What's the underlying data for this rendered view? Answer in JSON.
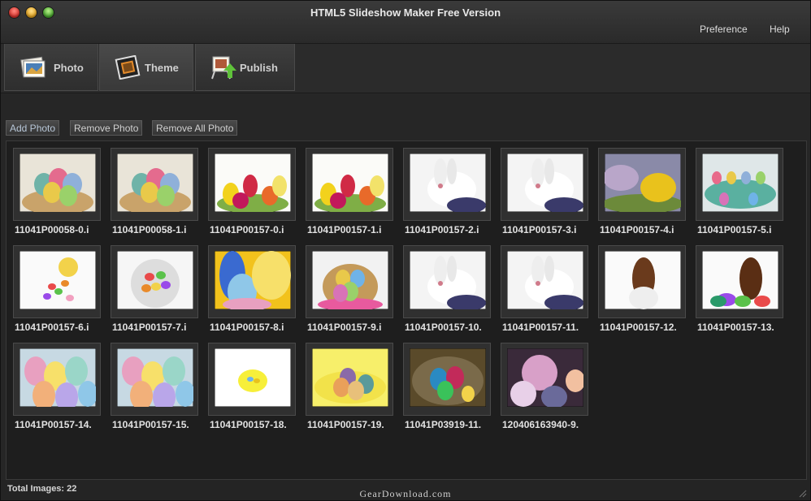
{
  "window": {
    "title": "HTML5 Slideshow Maker Free Version",
    "menu": {
      "preference": "Preference",
      "help": "Help"
    }
  },
  "tabs": [
    {
      "label": "Photo",
      "icon": "photo-stack-icon"
    },
    {
      "label": "Theme",
      "icon": "theme-frame-icon"
    },
    {
      "label": "Publish",
      "icon": "publish-upload-icon"
    }
  ],
  "toolbar": {
    "add": "Add Photo",
    "remove": "Remove Photo",
    "remove_all": "Remove All Photo"
  },
  "photos": [
    {
      "name": "11041P00058-0.i",
      "theme": "eggs-basket"
    },
    {
      "name": "11041P00058-1.i",
      "theme": "eggs-basket"
    },
    {
      "name": "11041P00157-0.i",
      "theme": "tulips"
    },
    {
      "name": "11041P00157-1.i",
      "theme": "tulips"
    },
    {
      "name": "11041P00157-2.i",
      "theme": "bunny"
    },
    {
      "name": "11041P00157-3.i",
      "theme": "bunny"
    },
    {
      "name": "11041P00157-4.i",
      "theme": "eggs-grass"
    },
    {
      "name": "11041P00157-5.i",
      "theme": "eggs-carton"
    },
    {
      "name": "11041P00157-6.i",
      "theme": "jellybeans"
    },
    {
      "name": "11041P00157-7.i",
      "theme": "jellybean-bowl"
    },
    {
      "name": "11041P00157-8.i",
      "theme": "egg-cup"
    },
    {
      "name": "11041P00157-9.i",
      "theme": "eggs-basket-pink"
    },
    {
      "name": "11041P00157-10.",
      "theme": "bunny"
    },
    {
      "name": "11041P00157-11.",
      "theme": "bunny"
    },
    {
      "name": "11041P00157-12.",
      "theme": "chocolate-bunny"
    },
    {
      "name": "11041P00157-13.",
      "theme": "chocolate-bunny-eggs"
    },
    {
      "name": "11041P00157-14.",
      "theme": "pastel-eggs"
    },
    {
      "name": "11041P00157-15.",
      "theme": "pastel-eggs"
    },
    {
      "name": "11041P00157-18.",
      "theme": "nest-small"
    },
    {
      "name": "11041P00157-19.",
      "theme": "nest-eggs"
    },
    {
      "name": "11041P03919-11.",
      "theme": "dark-eggs"
    },
    {
      "name": "120406163940-9.",
      "theme": "decorated-eggs"
    }
  ],
  "status": {
    "total": "Total Images: 22"
  },
  "watermark": "GearDownload.com"
}
